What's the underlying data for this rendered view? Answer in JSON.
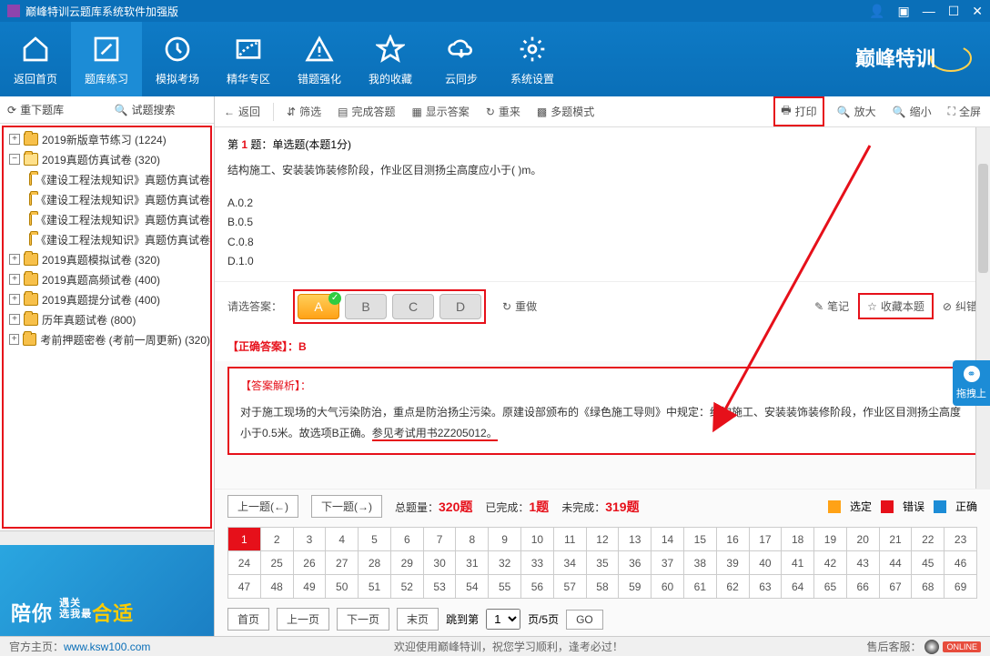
{
  "titlebar": {
    "title": "巅峰特训云题库系统软件加强版"
  },
  "nav": {
    "items": [
      {
        "label": "返回首页"
      },
      {
        "label": "题库练习"
      },
      {
        "label": "模拟考场"
      },
      {
        "label": "精华专区"
      },
      {
        "label": "错题强化"
      },
      {
        "label": "我的收藏"
      },
      {
        "label": "云同步"
      },
      {
        "label": "系统设置"
      }
    ],
    "brand": "巅峰特训"
  },
  "sidebar_top": {
    "reload": "重下题库",
    "search": "试题搜索"
  },
  "tree": [
    {
      "indent": 0,
      "exp": "+",
      "label": "2019新版章节练习 (1224)",
      "open": false
    },
    {
      "indent": 0,
      "exp": "−",
      "label": "2019真题仿真试卷 (320)",
      "open": true
    },
    {
      "indent": 1,
      "exp": "",
      "label": "《建设工程法规知识》真题仿真试卷",
      "open": false
    },
    {
      "indent": 1,
      "exp": "",
      "label": "《建设工程法规知识》真题仿真试卷",
      "open": false
    },
    {
      "indent": 1,
      "exp": "",
      "label": "《建设工程法规知识》真题仿真试卷",
      "open": false
    },
    {
      "indent": 1,
      "exp": "",
      "label": "《建设工程法规知识》真题仿真试卷",
      "open": false
    },
    {
      "indent": 0,
      "exp": "+",
      "label": "2019真题模拟试卷 (320)",
      "open": false
    },
    {
      "indent": 0,
      "exp": "+",
      "label": "2019真题高频试卷 (400)",
      "open": false
    },
    {
      "indent": 0,
      "exp": "+",
      "label": "2019真题提分试卷 (400)",
      "open": false
    },
    {
      "indent": 0,
      "exp": "+",
      "label": "历年真题试卷 (800)",
      "open": false
    },
    {
      "indent": 0,
      "exp": "+",
      "label": "考前押题密卷 (考前一周更新) (320)",
      "open": false
    }
  ],
  "ad": {
    "line1": "陪你",
    "line2_a": "遇关",
    "line2_b": "选我最",
    "accent": "合适"
  },
  "toolbar": {
    "back": "返回",
    "filter": "筛选",
    "finish": "完成答题",
    "show": "显示答案",
    "reset": "重来",
    "multi": "多题模式",
    "print": "打印",
    "zoomin": "放大",
    "zoomout": "缩小",
    "full": "全屏"
  },
  "question": {
    "head_pre": "第 ",
    "num": "1",
    "head_post": " 题：单选题(本题1分)",
    "text": "结构施工、安装装饰装修阶段，作业区目测扬尘高度应小于( )m。",
    "opts": [
      "A.0.2",
      "B.0.5",
      "C.0.8",
      "D.1.0"
    ]
  },
  "answer_bar": {
    "label": "请选答案：",
    "options": [
      "A",
      "B",
      "C",
      "D"
    ],
    "selected": "A",
    "redo": "重做",
    "note": "笔记",
    "fav": "收藏本题",
    "report": "纠错"
  },
  "correct": {
    "label": "【正确答案】：",
    "value": "B"
  },
  "analysis": {
    "title": "【答案解析】：",
    "body_pre": "对于施工现场的大气污染防治，重点是防治扬尘污染。原建设部颁布的《绿色施工导则》中规定：结构施工、安装装饰装修阶段，作业区目测扬尘高度小于0.5米。故选项B正确。",
    "ref": "参见考试用书2Z205012。"
  },
  "nav_stats": {
    "prev": "上一题(←)",
    "next": "下一题(→)",
    "total_lbl": "总题量：",
    "total": "320题",
    "done_lbl": "已完成：",
    "done": "1题",
    "undone_lbl": "未完成：",
    "undone": "319题",
    "legend": {
      "sel": "选定",
      "wrong": "错误",
      "right": "正确"
    }
  },
  "grid": {
    "rows": 3,
    "cols": 23,
    "total": 69,
    "current": 1
  },
  "pager": {
    "first": "首页",
    "prev": "上一页",
    "next": "下一页",
    "last": "末页",
    "jump_lbl": "跳到第",
    "jump_val": "1",
    "total_lbl": "页/5页",
    "go": "GO"
  },
  "side_handle": "拖拽上",
  "status": {
    "home_lbl": "官方主页：",
    "home_url": "www.ksw100.com",
    "center": "欢迎使用巅峰特训，祝您学习顺利，逢考必过！",
    "service_lbl": "售后客服：",
    "online": "ONLINE"
  }
}
